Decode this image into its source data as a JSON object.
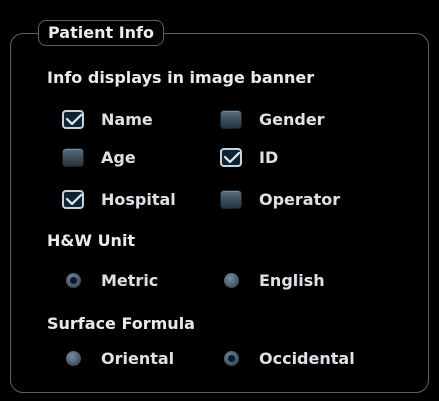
{
  "panel": {
    "title": "Patient Info"
  },
  "banner_section": {
    "heading": "Info displays in image banner",
    "options": [
      {
        "label": "Name",
        "checked": true
      },
      {
        "label": "Gender",
        "checked": false
      },
      {
        "label": "Age",
        "checked": false
      },
      {
        "label": "ID",
        "checked": true
      },
      {
        "label": "Hospital",
        "checked": true
      },
      {
        "label": "Operator",
        "checked": false
      }
    ]
  },
  "hw_unit": {
    "heading": "H&W Unit",
    "options": [
      {
        "label": "Metric",
        "selected": true
      },
      {
        "label": "English",
        "selected": false
      }
    ]
  },
  "surface_formula": {
    "heading": "Surface Formula",
    "options": [
      {
        "label": "Oriental",
        "selected": false
      },
      {
        "label": "Occidental",
        "selected": true
      }
    ]
  },
  "colors": {
    "background": "#000000",
    "border": "#5c6166",
    "text": "#e6e9ec",
    "control_fill": "#4d5f6d",
    "checked_fill": "#0d2436"
  },
  "icons": {
    "checked": "checkmark-icon"
  }
}
